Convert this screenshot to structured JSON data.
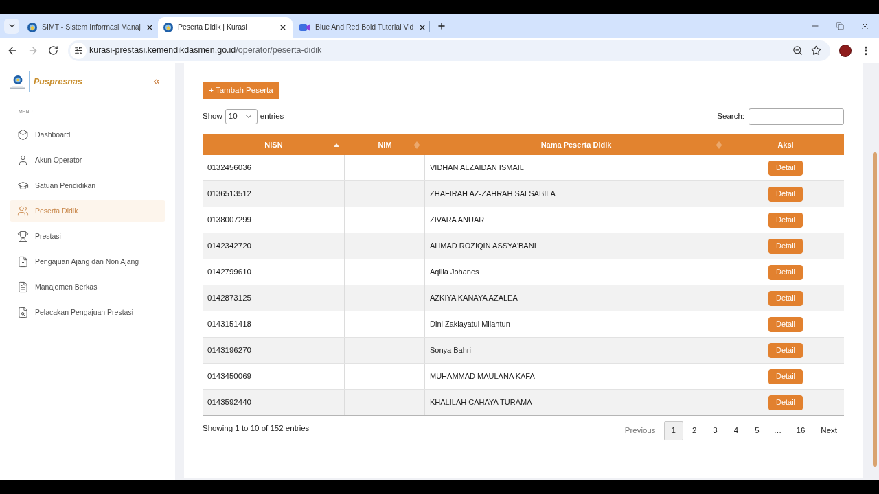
{
  "browser": {
    "tabs": [
      {
        "title": "SIMT - Sistem Informasi Manaj",
        "selected": false
      },
      {
        "title": "Peserta Didik | Kurasi",
        "selected": true
      },
      {
        "title": "Blue And Red Bold Tutorial Vid",
        "selected": false
      }
    ],
    "can_go_forward": false,
    "url": {
      "host": "kurasi-prestasi.kemendikdasmen.go.id",
      "path": "/operator/peserta-didik"
    }
  },
  "sidebar": {
    "logo_text": "Puspresnas",
    "section_label": "MENU",
    "items": [
      {
        "label": "Dashboard",
        "selected": false
      },
      {
        "label": "Akun Operator",
        "selected": false
      },
      {
        "label": "Satuan Pendidikan",
        "selected": false
      },
      {
        "label": "Peserta Didik",
        "selected": true
      },
      {
        "label": "Prestasi",
        "selected": false
      },
      {
        "label": "Pengajuan Ajang dan Non Ajang",
        "selected": false
      },
      {
        "label": "Manajemen Berkas",
        "selected": false
      },
      {
        "label": "Pelacakan Pengajuan Prestasi",
        "selected": false
      }
    ]
  },
  "add_button": "+ Tambah Peserta",
  "table_controls": {
    "show_label": "Show",
    "page_size": "10",
    "entries_label": "entries",
    "search_label": "Search:"
  },
  "table": {
    "columns": [
      {
        "label": "NISN",
        "sorted": true
      },
      {
        "label": "NIM",
        "sorted": false
      },
      {
        "label": "Nama Peserta Didik",
        "sorted": false
      },
      {
        "label": "Aksi"
      }
    ],
    "rows": [
      {
        "nisn": "0132456036",
        "name": "VIDHAN ALZAIDAN ISMAIL",
        "action": "Detail"
      },
      {
        "nisn": "0136513512",
        "name": "ZHAFIRAH AZ-ZAHRAH SALSABILA",
        "action": "Detail"
      },
      {
        "nisn": "0138007299",
        "name": "ZIVARA ANUAR",
        "action": "Detail"
      },
      {
        "nisn": "0142342720",
        "name": "AHMAD ROZIQIN ASSYA'BANI",
        "action": "Detail"
      },
      {
        "nisn": "0142799610",
        "name": "Aqilla Johanes",
        "action": "Detail"
      },
      {
        "nisn": "0142873125",
        "name": "AZKIYA KANAYA AZALEA",
        "action": "Detail"
      },
      {
        "nisn": "0143151418",
        "name": "Dini Zakiayatul Milahtun",
        "action": "Detail"
      },
      {
        "nisn": "0143196270",
        "name": "Sonya Bahri",
        "action": "Detail"
      },
      {
        "nisn": "0143450069",
        "name": "MUHAMMAD MAULANA KAFA",
        "action": "Detail"
      },
      {
        "nisn": "0143592440",
        "name": "KHALILAH CAHAYA TURAMA",
        "action": "Detail"
      }
    ]
  },
  "footer": {
    "info": "Showing 1 to 10 of 152 entries",
    "pagination": [
      {
        "kind": "nav",
        "label": "Previous",
        "disabled": true
      },
      {
        "kind": "page",
        "label": "1",
        "selected": true
      },
      {
        "kind": "page",
        "label": "2",
        "selected": false
      },
      {
        "kind": "page",
        "label": "3",
        "selected": false
      },
      {
        "kind": "page",
        "label": "4",
        "selected": false
      },
      {
        "kind": "page",
        "label": "5",
        "selected": false
      },
      {
        "kind": "ellipsis",
        "label": "…"
      },
      {
        "kind": "page",
        "label": "16",
        "selected": false
      },
      {
        "kind": "nav",
        "label": "Next",
        "disabled": false
      }
    ]
  }
}
